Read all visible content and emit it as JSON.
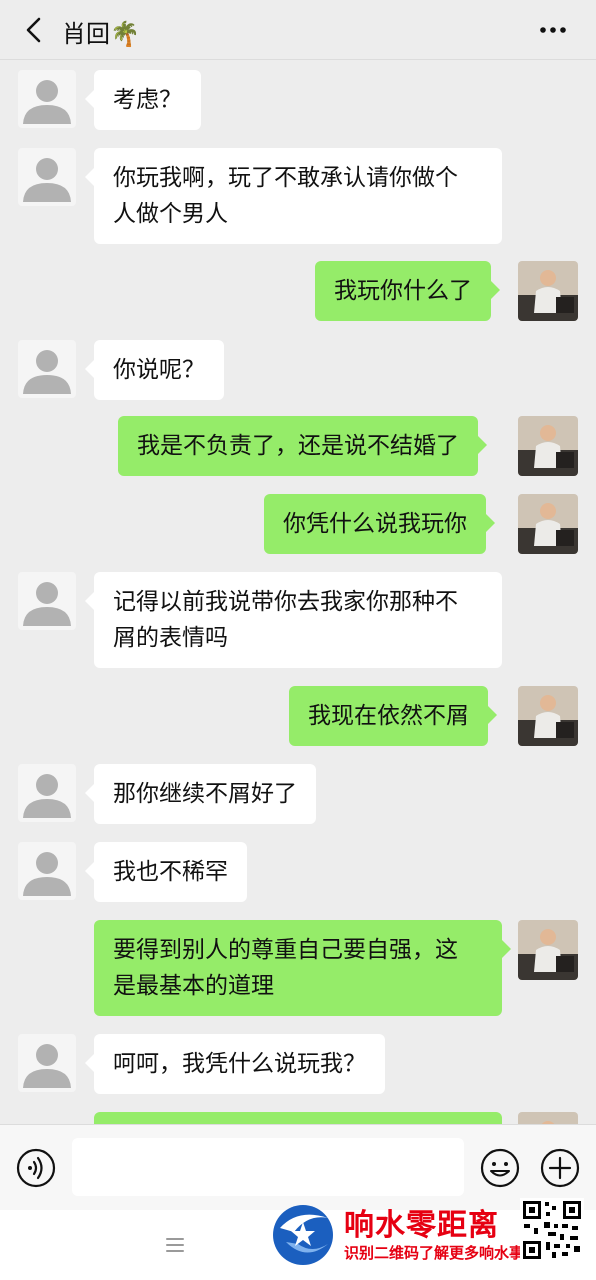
{
  "header": {
    "title": "肖回🌴",
    "back_icon": "chevron-left-icon",
    "more_icon": "ellipsis-icon"
  },
  "messages": [
    {
      "side": "left",
      "text": "考虑？"
    },
    {
      "side": "left",
      "text": "你玩我啊，玩了不敢承认请你做个\n人做个男人"
    },
    {
      "side": "right",
      "text": "我玩你什么了"
    },
    {
      "side": "left",
      "text": "你说呢？"
    },
    {
      "side": "right",
      "text": "我是不负责了，还是说不结婚了"
    },
    {
      "side": "right",
      "text": "你凭什么说我玩你"
    },
    {
      "side": "left",
      "text": "记得以前我说带你去我家你那种不\n屑的表情吗"
    },
    {
      "side": "right",
      "text": "我现在依然不屑"
    },
    {
      "side": "left",
      "text": "那你继续不屑好了"
    },
    {
      "side": "left",
      "text": "我也不稀罕"
    },
    {
      "side": "right",
      "text": "要得到别人的尊重自己要自强，这\n是最基本的道理"
    },
    {
      "side": "left",
      "text": "呵呵，我凭什么说玩我？"
    },
    {
      "side": "right",
      "text": ""
    }
  ],
  "input_bar": {
    "voice_icon": "voice-icon",
    "input_value": "",
    "emoji_icon": "emoji-icon",
    "plus_icon": "plus-icon"
  },
  "nav": {
    "menu_icon": "hamburger-icon"
  },
  "watermark": {
    "brand": "响水零距离",
    "caption": "识别二维码了解更多响水事",
    "logo_icon": "brand-logo-icon",
    "qr_icon": "qr-code-icon"
  },
  "colors": {
    "background": "#ededed",
    "left_bubble": "#ffffff",
    "right_bubble": "#95ec69",
    "watermark_red": "#e60012"
  }
}
